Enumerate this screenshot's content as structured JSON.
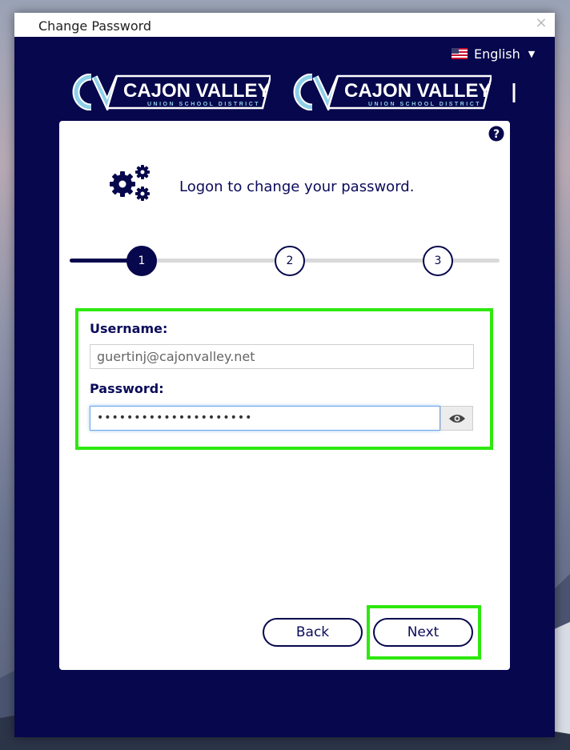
{
  "window": {
    "title": "Change Password",
    "close_glyph": "×"
  },
  "language": {
    "selected": "English",
    "flag_icon": "us-flag-icon",
    "caret_icon": "caret-down-icon"
  },
  "branding": {
    "logo_text": "CAJON VALLEY",
    "logo_subtext": "UNION SCHOOL DISTRICT"
  },
  "card": {
    "heading": "Logon to change your password.",
    "help_icon": "question-circle-icon",
    "gears_icon": "gears-icon"
  },
  "stepper": {
    "steps": [
      "1",
      "2",
      "3"
    ],
    "current_step": 1
  },
  "form": {
    "username_label": "Username:",
    "username_value": "guertinj@cajonvalley.net",
    "password_label": "Password:",
    "password_value": "•••••••••••••••••••••",
    "show_password_icon": "eye-icon"
  },
  "buttons": {
    "back": "Back",
    "next": "Next"
  },
  "colors": {
    "brand_navy": "#07074d",
    "highlight_green": "#2ee80f"
  }
}
